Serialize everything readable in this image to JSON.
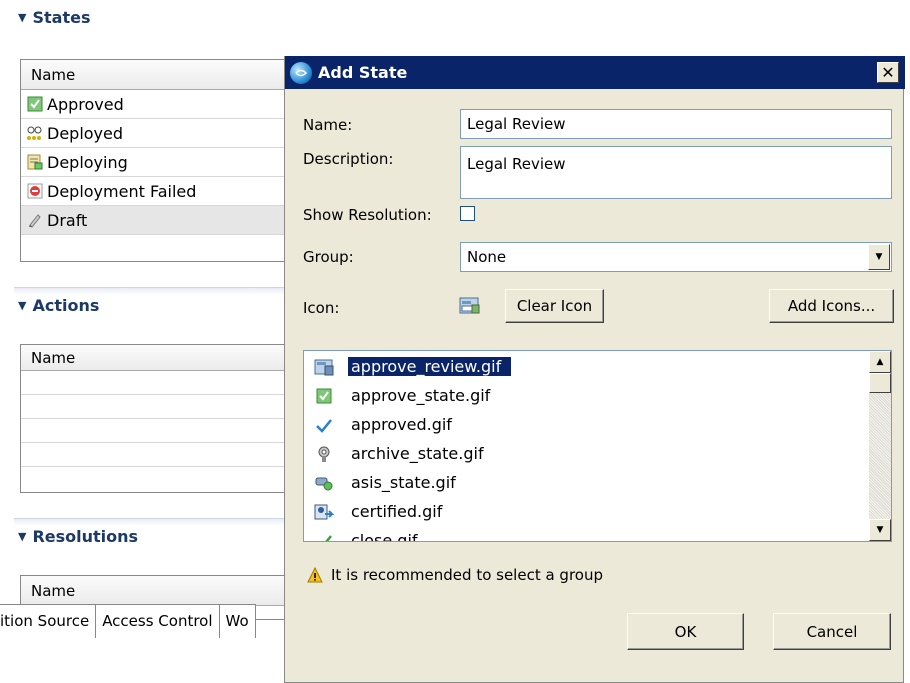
{
  "editor": {
    "states": {
      "header": "States",
      "column": "Name",
      "rows": [
        {
          "label": "Approved",
          "icon": "approved-check-icon"
        },
        {
          "label": "Deployed",
          "icon": "deployed-glasses-icon"
        },
        {
          "label": "Deploying",
          "icon": "deploying-icon"
        },
        {
          "label": "Deployment Failed",
          "icon": "deployment-failed-icon"
        },
        {
          "label": "Draft",
          "icon": "pencil-icon"
        }
      ]
    },
    "actions": {
      "header": "Actions",
      "column": "Name"
    },
    "resolutions": {
      "header": "Resolutions",
      "column": "Name"
    },
    "tabs": [
      "ition Source",
      "Access Control",
      "Wo"
    ]
  },
  "dialog": {
    "title": "Add State",
    "name_label": "Name:",
    "name_value": "Legal Review",
    "description_label": "Description:",
    "description_value": "Legal Review",
    "show_resolution_label": "Show Resolution:",
    "show_resolution_checked": false,
    "group_label": "Group:",
    "group_value": "None",
    "icon_label": "Icon:",
    "clear_icon_label": "Clear Icon",
    "add_icons_label": "Add Icons...",
    "icon_files": [
      {
        "name": "approve_review.gif",
        "selected": true
      },
      {
        "name": "approve_state.gif",
        "selected": false
      },
      {
        "name": "approved.gif",
        "selected": false
      },
      {
        "name": "archive_state.gif",
        "selected": false
      },
      {
        "name": "asis_state.gif",
        "selected": false
      },
      {
        "name": "certified.gif",
        "selected": false
      },
      {
        "name": "close.gif",
        "selected": false
      }
    ],
    "warning": "It is recommended to select a group",
    "ok_label": "OK",
    "cancel_label": "Cancel"
  },
  "colors": {
    "titlebar": "#0a246a",
    "dialog_bg": "#ece9d8",
    "selection": "#0a246a",
    "section_header": "#1d3a66"
  }
}
